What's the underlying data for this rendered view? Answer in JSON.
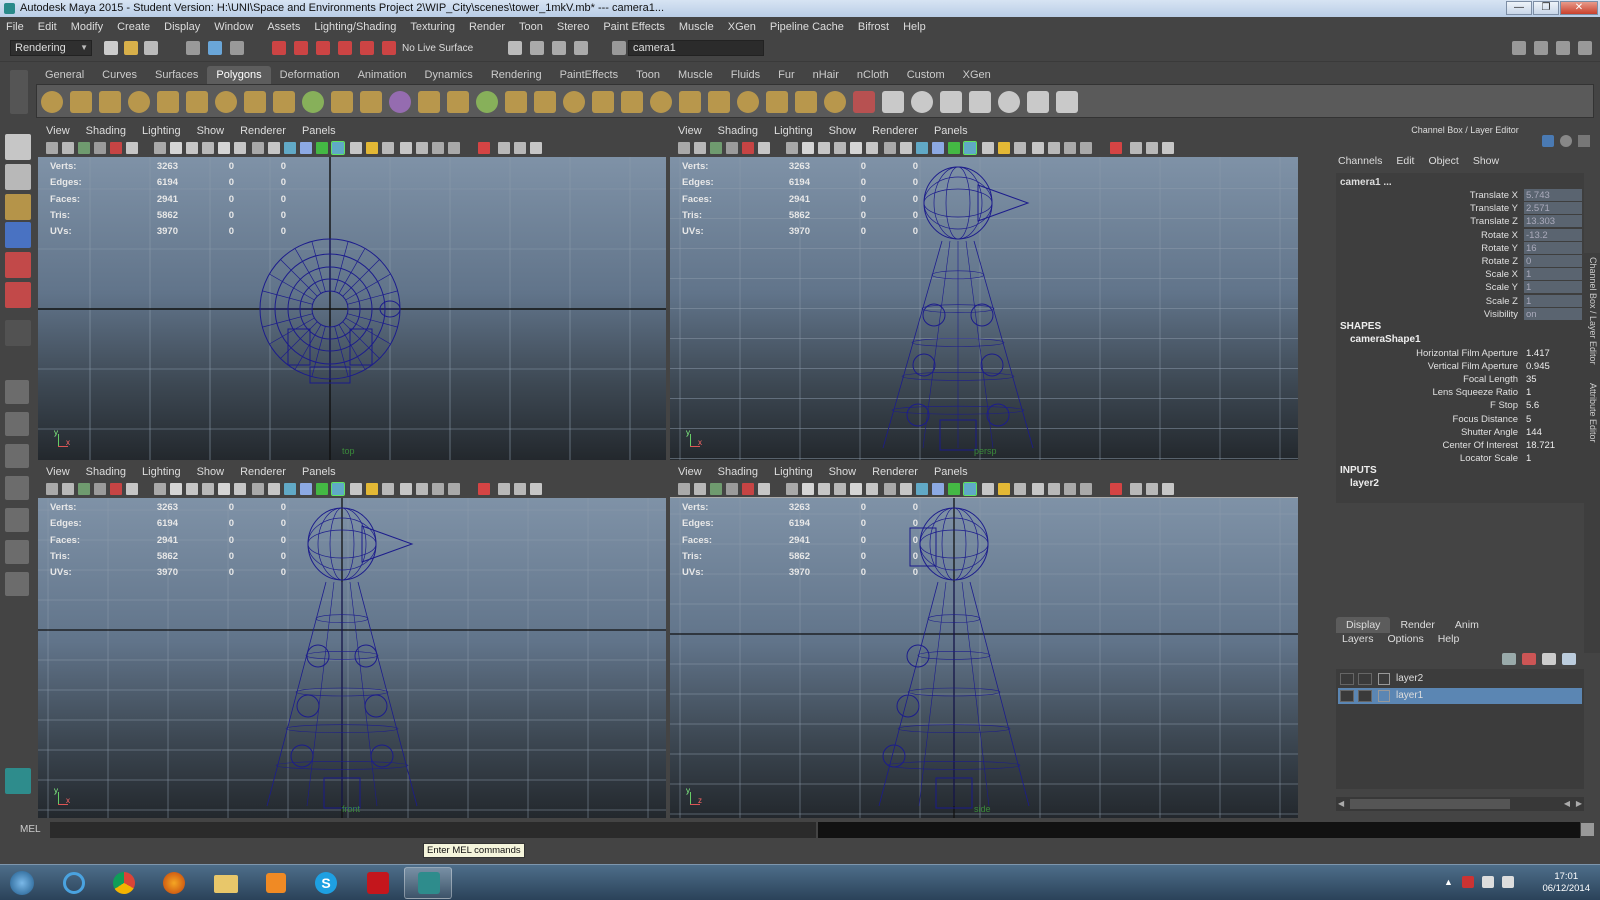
{
  "window": {
    "title": "Autodesk Maya 2015 - Student Version: H:\\UNI\\Space and Environments Project 2\\WIP_City\\scenes\\tower_1mkV.mb*  ---  camera1...",
    "min": "—",
    "max": "❐",
    "close": "✕"
  },
  "menubar": [
    "File",
    "Edit",
    "Modify",
    "Create",
    "Display",
    "Window",
    "Assets",
    "Lighting/Shading",
    "Texturing",
    "Render",
    "Toon",
    "Stereo",
    "Paint Effects",
    "Muscle",
    "XGen",
    "Pipeline Cache",
    "Bifrost",
    "Help"
  ],
  "statusline": {
    "menuset": "Rendering",
    "live_surface": "No Live Surface",
    "camera_field": "camera1"
  },
  "shelf": {
    "tabs": [
      "General",
      "Curves",
      "Surfaces",
      "Polygons",
      "Deformation",
      "Animation",
      "Dynamics",
      "Rendering",
      "PaintEffects",
      "Toon",
      "Muscle",
      "Fluids",
      "Fur",
      "nHair",
      "nCloth",
      "Custom",
      "XGen"
    ],
    "active": "Polygons"
  },
  "panel_menu": [
    "View",
    "Shading",
    "Lighting",
    "Show",
    "Renderer",
    "Panels"
  ],
  "hud": {
    "labels": [
      "Verts:",
      "Edges:",
      "Faces:",
      "Tris:",
      "UVs:"
    ],
    "rows": [
      [
        "3263",
        "0",
        "0"
      ],
      [
        "6194",
        "0",
        "0"
      ],
      [
        "2941",
        "0",
        "0"
      ],
      [
        "5862",
        "0",
        "0"
      ],
      [
        "3970",
        "0",
        "0"
      ]
    ]
  },
  "viewports": [
    {
      "name": "top",
      "axis_a": "y",
      "axis_b": "x"
    },
    {
      "name": "persp",
      "axis_a": "y",
      "axis_b": "x"
    },
    {
      "name": "front",
      "axis_a": "y",
      "axis_b": "x"
    },
    {
      "name": "side",
      "axis_a": "y",
      "axis_b": "z"
    }
  ],
  "channelbox": {
    "title": "Channel Box / Layer Editor",
    "menu": [
      "Channels",
      "Edit",
      "Object",
      "Show"
    ],
    "object": "camera1 ...",
    "attrs": [
      {
        "n": "Translate X",
        "v": "5.743"
      },
      {
        "n": "Translate Y",
        "v": "2.571"
      },
      {
        "n": "Translate Z",
        "v": "13.303"
      },
      {
        "n": "Rotate X",
        "v": "-13.2"
      },
      {
        "n": "Rotate Y",
        "v": "16"
      },
      {
        "n": "Rotate Z",
        "v": "0"
      },
      {
        "n": "Scale X",
        "v": "1"
      },
      {
        "n": "Scale Y",
        "v": "1"
      },
      {
        "n": "Scale Z",
        "v": "1"
      },
      {
        "n": "Visibility",
        "v": "on"
      }
    ],
    "shapes_title": "SHAPES",
    "shape_name": "cameraShape1",
    "shape_attrs": [
      {
        "n": "Horizontal Film Aperture",
        "v": "1.417"
      },
      {
        "n": "Vertical Film Aperture",
        "v": "0.945"
      },
      {
        "n": "Focal Length",
        "v": "35"
      },
      {
        "n": "Lens Squeeze Ratio",
        "v": "1"
      },
      {
        "n": "F Stop",
        "v": "5.6"
      },
      {
        "n": "Focus Distance",
        "v": "5"
      },
      {
        "n": "Shutter Angle",
        "v": "144"
      },
      {
        "n": "Center Of Interest",
        "v": "18.721"
      },
      {
        "n": "Locator Scale",
        "v": "1"
      }
    ],
    "inputs_title": "INPUTS",
    "input_name": "layer2"
  },
  "layer_editor": {
    "tabs": [
      "Display",
      "Render",
      "Anim"
    ],
    "active": "Display",
    "menu": [
      "Layers",
      "Options",
      "Help"
    ],
    "layers": [
      "layer2",
      "layer1"
    ],
    "selected": "layer1"
  },
  "side_tabs": [
    "Channel Box / Layer Editor",
    "Attribute Editor"
  ],
  "command": {
    "label": "MEL",
    "tooltip": "Enter MEL commands"
  },
  "taskbar": {
    "time": "17:01",
    "date": "06/12/2014"
  }
}
